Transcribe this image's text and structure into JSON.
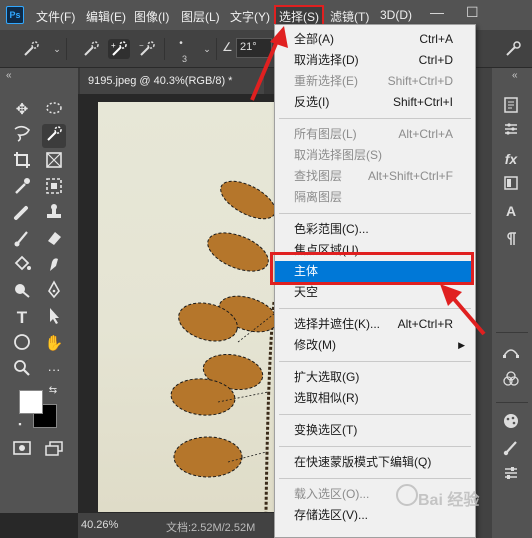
{
  "menubar": {
    "app_logo": "Ps",
    "items": [
      {
        "label": "文件(F)"
      },
      {
        "label": "编辑(E)"
      },
      {
        "label": "图像(I)"
      },
      {
        "label": "图层(L)"
      },
      {
        "label": "文字(Y)"
      },
      {
        "label": "选择(S)"
      },
      {
        "label": "滤镜(T)"
      },
      {
        "label": "3D(D)"
      }
    ],
    "minimize": "—",
    "restore": "☐"
  },
  "options": {
    "brush_size": "3",
    "angle_symbol": "∠",
    "angle_value": "21°"
  },
  "document": {
    "tab_title": "9195.jpeg @ 40.3%(RGB/8) *",
    "zoom": "40.26%",
    "doc_info": "文档:2.52M/2.52M"
  },
  "select_menu": {
    "groups": [
      [
        {
          "label": "全部(A)",
          "shortcut": "Ctrl+A",
          "disabled": false
        },
        {
          "label": "取消选择(D)",
          "shortcut": "Ctrl+D",
          "disabled": false
        },
        {
          "label": "重新选择(E)",
          "shortcut": "Shift+Ctrl+D",
          "disabled": true
        },
        {
          "label": "反选(I)",
          "shortcut": "Shift+Ctrl+I",
          "disabled": false
        }
      ],
      [
        {
          "label": "所有图层(L)",
          "shortcut": "Alt+Ctrl+A",
          "disabled": true
        },
        {
          "label": "取消选择图层(S)",
          "shortcut": "",
          "disabled": true
        },
        {
          "label": "查找图层",
          "shortcut": "Alt+Shift+Ctrl+F",
          "disabled": true
        },
        {
          "label": "隔离图层",
          "shortcut": "",
          "disabled": true
        }
      ],
      [
        {
          "label": "色彩范围(C)...",
          "shortcut": "",
          "disabled": false
        },
        {
          "label": "焦点区域(U)...",
          "shortcut": "",
          "disabled": false
        },
        {
          "label": "主体",
          "shortcut": "",
          "disabled": false,
          "highlighted": true
        },
        {
          "label": "天空",
          "shortcut": "",
          "disabled": false
        }
      ],
      [
        {
          "label": "选择并遮住(K)...",
          "shortcut": "Alt+Ctrl+R",
          "disabled": false
        },
        {
          "label": "修改(M)",
          "shortcut": "",
          "disabled": false,
          "submenu": true
        }
      ],
      [
        {
          "label": "扩大选取(G)",
          "shortcut": "",
          "disabled": false
        },
        {
          "label": "选取相似(R)",
          "shortcut": "",
          "disabled": false
        }
      ],
      [
        {
          "label": "变换选区(T)",
          "shortcut": "",
          "disabled": false
        }
      ],
      [
        {
          "label": "在快速蒙版模式下编辑(Q)",
          "shortcut": "",
          "disabled": false
        }
      ],
      [
        {
          "label": "载入选区(O)...",
          "shortcut": "",
          "disabled": true
        },
        {
          "label": "存储选区(V)...",
          "shortcut": "",
          "disabled": false
        }
      ]
    ]
  },
  "colors": {
    "highlight": "#0078d7",
    "annotation_red": "#e02020",
    "foreground_swatch": "#ffffff",
    "background_swatch": "#000000"
  },
  "watermark": {
    "text": "Bai 经验"
  }
}
